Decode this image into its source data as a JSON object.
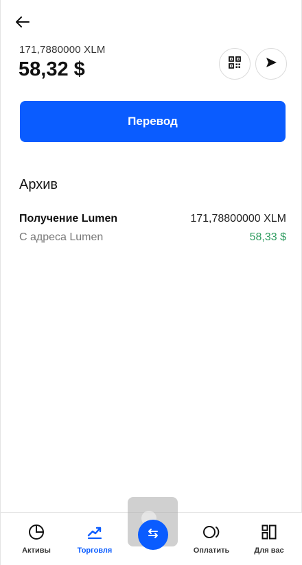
{
  "header": {
    "back_icon": "arrow-left-icon",
    "crypto_balance": "171,7880000 XLM",
    "fiat_balance": "58,32 $",
    "qr_icon": "qr-code-icon",
    "send_icon": "send-icon"
  },
  "actions": {
    "transfer_label": "Перевод"
  },
  "archive": {
    "title": "Архив",
    "transactions": [
      {
        "title": "Получение Lumen",
        "subtitle": "С адреса Lumen",
        "crypto_amount": "171,78800000 XLM",
        "fiat_amount": "58,33 $"
      }
    ]
  },
  "bottom_nav": {
    "items": [
      {
        "label": "Активы",
        "icon": "pie-chart-icon"
      },
      {
        "label": "Торговля",
        "icon": "trend-up-icon",
        "active": true
      },
      {
        "label": "",
        "icon": "swap-icon"
      },
      {
        "label": "Оплатить",
        "icon": "pay-icon"
      },
      {
        "label": "Для вас",
        "icon": "grid-icon"
      }
    ]
  },
  "colors": {
    "accent": "#0a5cff",
    "positive": "#2e9b5f"
  }
}
